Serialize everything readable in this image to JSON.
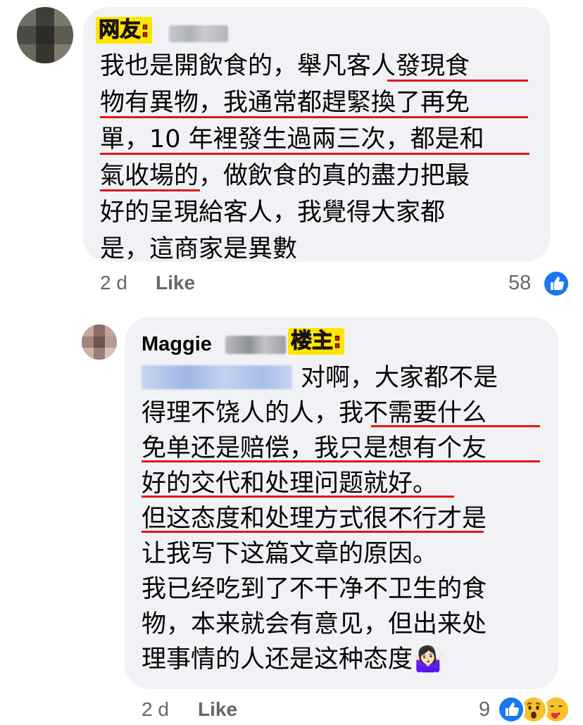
{
  "comment1": {
    "tag": "网友:",
    "author_name": "",
    "text_lines": [
      "我也是開飲食的，舉凡客人發現食",
      "物有異物，我通常都趕緊換了再免",
      "單，10 年裡發生過兩三次，都是和",
      "氣收場的，做飲食的真的盡力把最",
      "好的呈現給客人，我覺得大家都",
      "是，這商家是異數"
    ],
    "time": "2 d",
    "like_label": "Like",
    "reaction_count": "58"
  },
  "comment2": {
    "tag": "楼主:",
    "author_name": "Maggie",
    "text_lines": [
      "对啊，大家都不是",
      "得理不饶人的人，我不需要什么",
      "免单还是赔偿，我只是想有个友",
      "好的交代和处理问题就好。",
      "但这态度和处理方式很不行才是",
      "让我写下这篇文章的原因。",
      "我已经吃到了不干净不卫生的食",
      "物，本来就会有意见，但出来处",
      "理事情的人还是这种态度🤷🏻‍♀️"
    ],
    "time": "2 d",
    "like_label": "Like",
    "reaction_count": "9"
  },
  "colors": {
    "bubble": "#f0f2f5",
    "highlight": "#ffe600",
    "tag_text": "#d9141a",
    "underline": "#e3141b",
    "like_blue": "#1877f2",
    "meta_gray": "#65676b"
  }
}
